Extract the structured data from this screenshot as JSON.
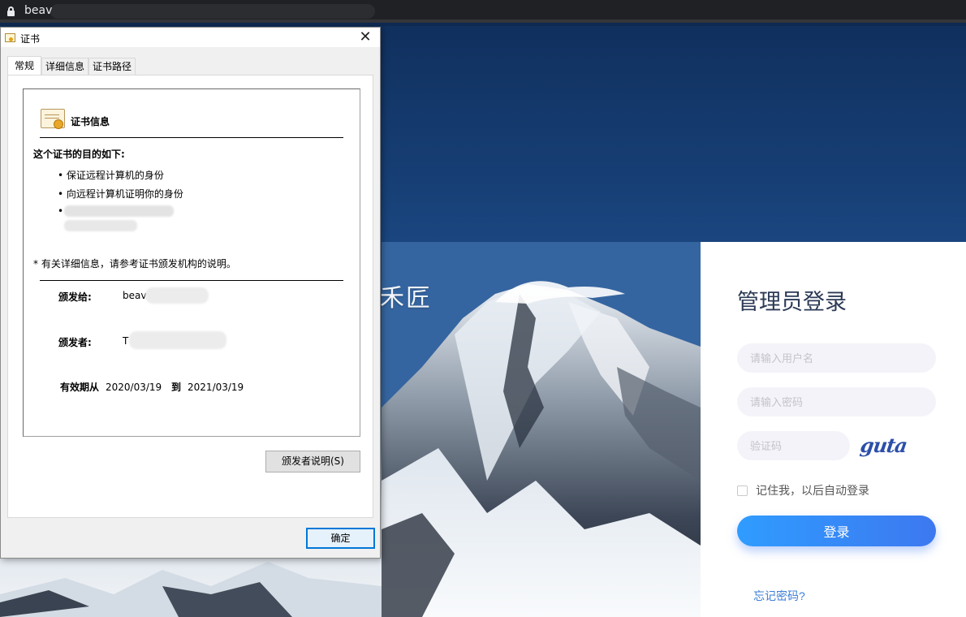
{
  "browser": {
    "url_visible": "beav"
  },
  "background": {
    "slogan": "禾匠"
  },
  "login": {
    "title": "管理员登录",
    "username_placeholder": "请输入用户名",
    "password_placeholder": "请输入密码",
    "captcha_placeholder": "验证码",
    "captcha_text": "guta",
    "remember_label": "记住我，以后自动登录",
    "login_button": "登录",
    "forgot_link": "忘记密码?",
    "accent_color": "#3d78f0"
  },
  "dialog": {
    "title": "证书",
    "close_symbol": "✕",
    "tabs": [
      "常规",
      "详细信息",
      "证书路径"
    ],
    "info_title": "证书信息",
    "purpose_heading": "这个证书的目的如下:",
    "purposes": [
      "• 保证远程计算机的身份",
      "• 向远程计算机证明你的身份",
      "•"
    ],
    "note": "* 有关详细信息，请参考证书颁发机构的说明。",
    "issued_to_label": "颁发给:",
    "issued_to_value": "beav",
    "issued_by_label": "颁发者:",
    "issued_by_value": "T",
    "validity_label": "有效期从",
    "valid_from": "2020/03/19",
    "validity_to": "到",
    "valid_to": "2021/03/19",
    "issuer_statement_button": "颁发者说明(S)",
    "ok_button": "确定"
  }
}
